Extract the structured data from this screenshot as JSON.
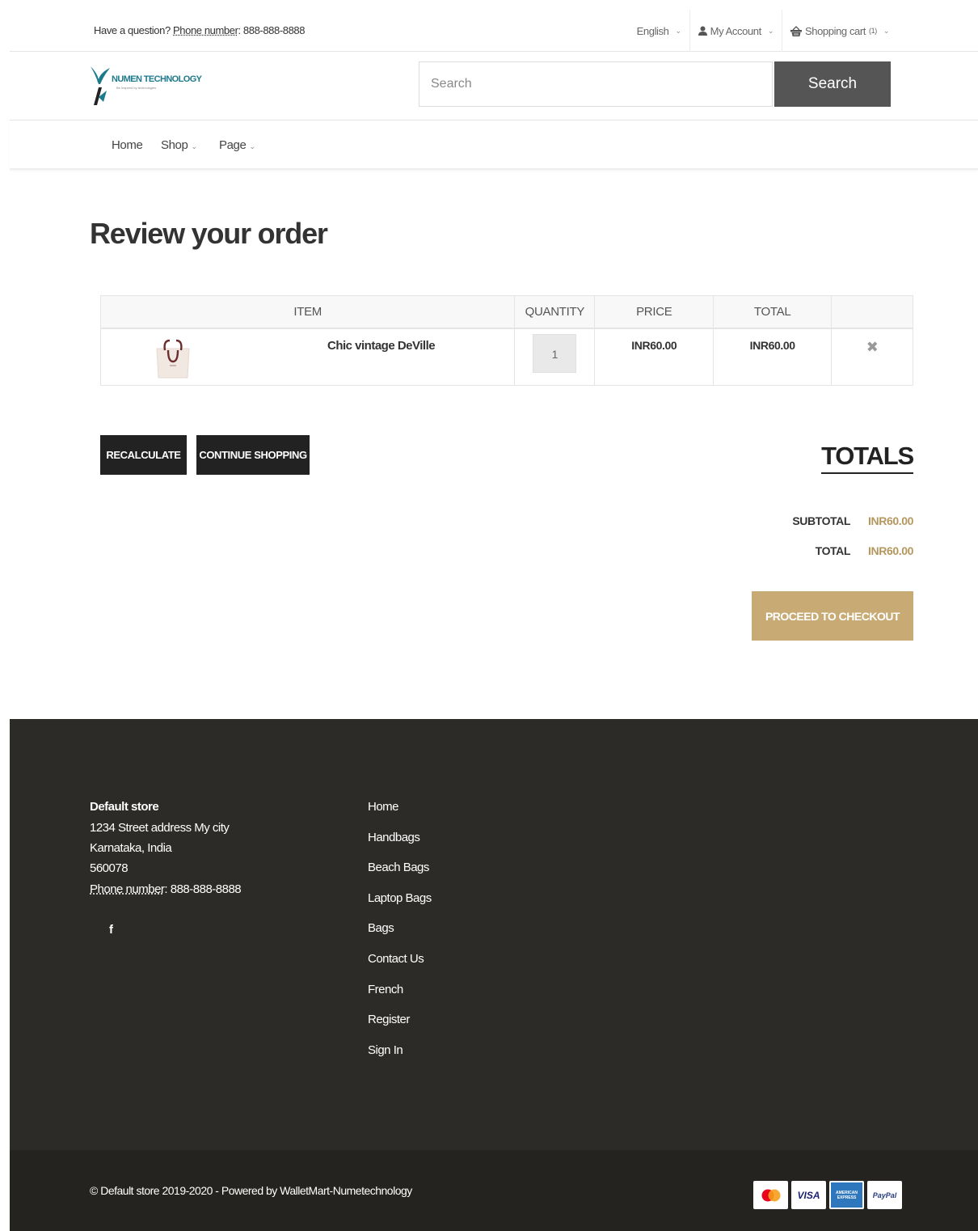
{
  "topbar": {
    "question": "Have a question?",
    "phone_label": "Phone number",
    "phone": ": 888-888-8888",
    "language": "English",
    "account": "My Account",
    "cart": "Shopping cart",
    "cart_count": "(1)"
  },
  "header": {
    "brand": "NUMEN TECHNOLOGY",
    "tagline": "Be Inspired by technologies",
    "search_placeholder": "Search",
    "search_button": "Search"
  },
  "nav": {
    "home": "Home",
    "shop": "Shop",
    "page": "Page"
  },
  "page_title": "Review your order",
  "cart": {
    "headers": {
      "item": "ITEM",
      "quantity": "QUANTITY",
      "price": "PRICE",
      "total": "TOTAL"
    },
    "items": [
      {
        "name": "Chic vintage DeVille",
        "quantity": "1",
        "price": "INR60.00",
        "total": "INR60.00"
      }
    ]
  },
  "buttons": {
    "recalculate": "RECALCULATE",
    "continue": "CONTINUE SHOPPING",
    "checkout": "PROCEED TO CHECKOUT"
  },
  "totals": {
    "title": "TOTALS",
    "subtotal_label": "SUBTOTAL",
    "subtotal": "INR60.00",
    "total_label": "TOTAL",
    "total": "INR60.00"
  },
  "footer": {
    "store": "Default store",
    "address1": "1234 Street address My city",
    "address2": "Karnataka, India",
    "zip": "560078",
    "phone_label": "Phone number",
    "phone": ": 888-888-8888",
    "links": [
      "Home",
      "Handbags",
      "Beach Bags",
      "Laptop Bags",
      "Bags",
      "Contact Us",
      "French",
      "Register",
      "Sign In"
    ],
    "copyright": "© Default store 2019-2020 - Powered by WalletMart-Numetechnology",
    "payments": {
      "visa": "VISA",
      "amex": "AMERICAN EXPRESS",
      "paypal": "PayPal"
    }
  },
  "colors": {
    "accent": "#c8ab74",
    "price": "#b4975e",
    "footer_bg": "#2c2b27",
    "dark_button": "#222222"
  }
}
